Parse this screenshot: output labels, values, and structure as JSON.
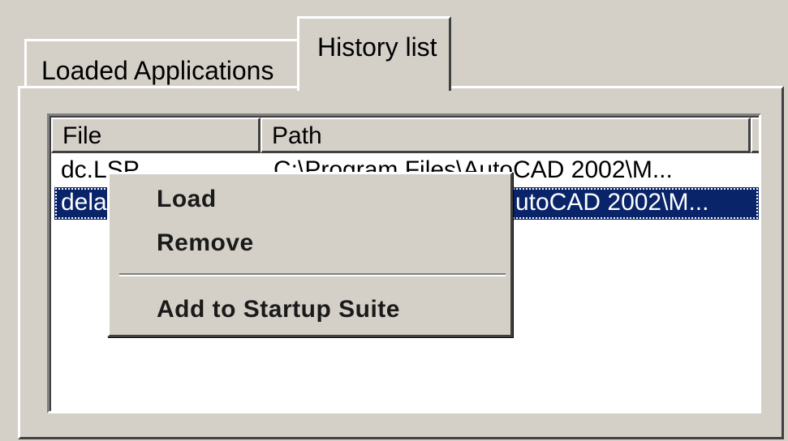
{
  "tabs": [
    {
      "label": "Loaded Applications",
      "active": false
    },
    {
      "label": "History list",
      "active": true
    }
  ],
  "list": {
    "columns": [
      "File",
      "Path"
    ],
    "rows": [
      {
        "file": "dc.LSP",
        "path": "C:\\Program Files\\AutoCAD 2002\\M...",
        "selected": false
      },
      {
        "file": "dela",
        "path": "utoCAD 2002\\M...",
        "selected": true
      }
    ]
  },
  "context_menu": {
    "items": [
      "Load",
      "Remove",
      "Add to Startup Suite"
    ]
  },
  "colors": {
    "face": "#d4d0c8",
    "selection": "#0a246a",
    "window": "#ffffff"
  }
}
